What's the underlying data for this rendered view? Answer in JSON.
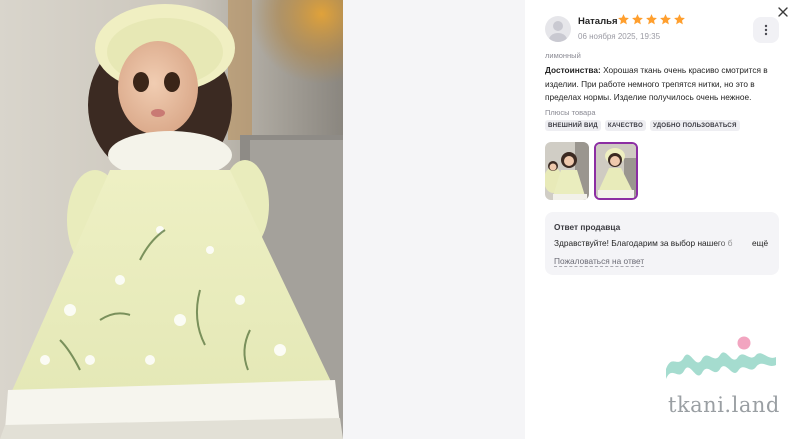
{
  "viewer": {
    "close_icon": "close-icon"
  },
  "review": {
    "author": "Наталья",
    "rating": 5,
    "rating_max": 5,
    "date": "06 ноября 2025, 19:35",
    "variant": "лимонный",
    "advantages_label": "Достоинства:",
    "advantages_text": "Хорошая ткань очень красиво смотрится в изделии. При работе немного трепятся нитки, но это в пределах нормы. Изделие получилось очень нежное.",
    "pros_title": "Плюсы товара",
    "tags": [
      "ВНЕШНИЙ ВИД",
      "КАЧЕСТВО",
      "УДОБНО ПОЛЬЗОВАТЬСЯ"
    ],
    "thumbnails_count": 2,
    "active_thumbnail": 2
  },
  "seller_reply": {
    "title": "Ответ продавца",
    "text": "Здравствуйте! Благодарим за выбор нашего б",
    "more_label": "ещё",
    "complain_label": "Пожаловаться на ответ"
  },
  "watermark": {
    "text": "tkani.land"
  },
  "colors": {
    "star": "#ff9f2e",
    "active_thumb_border": "#8c2ea3",
    "tag_bg": "#eeeef2",
    "seller_box_bg": "#f4f4f7",
    "watermark_teal": "#8fd3c3",
    "watermark_pink": "#f2a5c0"
  }
}
